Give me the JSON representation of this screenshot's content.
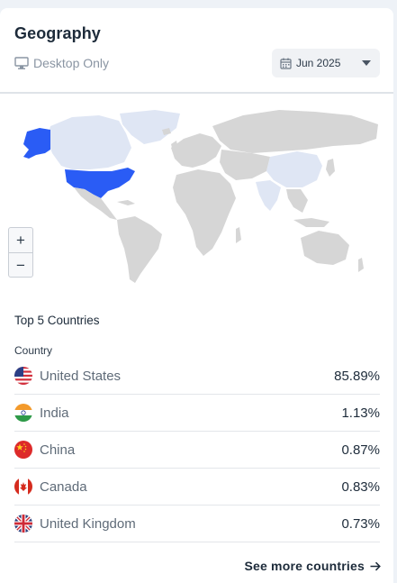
{
  "widget": {
    "title": "Geography",
    "device_filter": "Desktop Only",
    "date_selector": {
      "value": "Jun 2025"
    }
  },
  "map": {
    "highlight_color": "#2a5cf5",
    "light_color": "#dfe6f4",
    "base_color": "#d6d6d6",
    "highlighted_country": "United States",
    "zoom_in_label": "+",
    "zoom_out_label": "−"
  },
  "top_countries": {
    "section_title": "Top 5 Countries",
    "column_header": "Country",
    "rows": [
      {
        "country": "United States",
        "percent": "85.89%",
        "flag": "us-flag-icon"
      },
      {
        "country": "India",
        "percent": "1.13%",
        "flag": "india-flag-icon"
      },
      {
        "country": "China",
        "percent": "0.87%",
        "flag": "china-flag-icon"
      },
      {
        "country": "Canada",
        "percent": "0.83%",
        "flag": "canada-flag-icon"
      },
      {
        "country": "United Kingdom",
        "percent": "0.73%",
        "flag": "uk-flag-icon"
      }
    ]
  },
  "footer": {
    "see_more_label": "See more countries"
  }
}
